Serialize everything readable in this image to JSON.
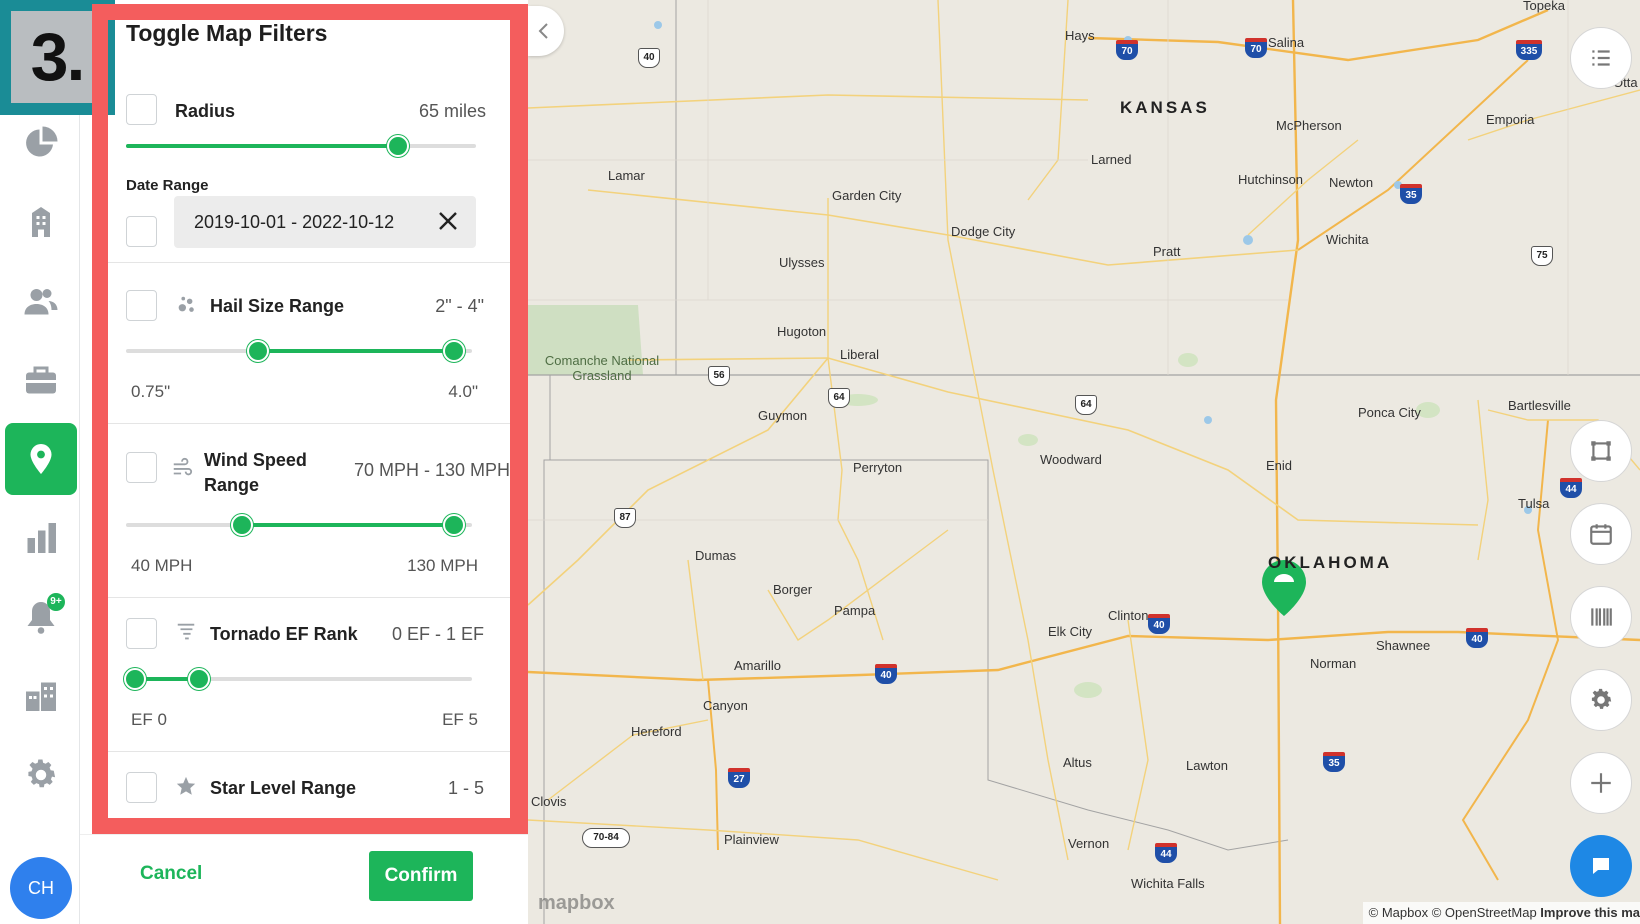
{
  "step_badge": "3.",
  "nav": {
    "items": [
      {
        "name": "dashboard"
      },
      {
        "name": "buildings"
      },
      {
        "name": "contacts"
      },
      {
        "name": "jobs"
      },
      {
        "name": "map"
      },
      {
        "name": "reports"
      },
      {
        "name": "notifications",
        "badge": "9+"
      },
      {
        "name": "organization"
      },
      {
        "name": "settings"
      }
    ],
    "avatar_initials": "CH"
  },
  "filters": {
    "title": "Toggle Map Filters",
    "radius": {
      "label": "Radius",
      "value": "65 miles"
    },
    "date_range": {
      "label": "Date Range",
      "value": "2019-10-01 - 2022-10-12"
    },
    "hail": {
      "label": "Hail Size Range",
      "value": "2\" - 4\"",
      "min": "0.75\"",
      "max": "4.0\""
    },
    "wind": {
      "label": "Wind Speed Range",
      "value": "70 MPH - 130 MPH",
      "min": "40 MPH",
      "max": "130 MPH"
    },
    "tornado": {
      "label": "Tornado EF Rank",
      "value": "0 EF - 1 EF",
      "min": "EF 0",
      "max": "EF 5"
    },
    "star": {
      "label": "Star Level Range",
      "value": "1 - 5"
    },
    "cancel_label": "Cancel",
    "confirm_label": "Confirm"
  },
  "map": {
    "states": {
      "kansas": "KANSAS",
      "oklahoma": "OKLAHOMA"
    },
    "cities": {
      "topeka": "Topeka",
      "hays": "Hays",
      "salina": "Salina",
      "mcpherson": "McPherson",
      "emporia": "Emporia",
      "otta": "Otta",
      "larned": "Larned",
      "lamar": "Lamar",
      "hutchinson": "Hutchinson",
      "newton": "Newton",
      "garden_city": "Garden City",
      "dodge_city": "Dodge City",
      "wichita": "Wichita",
      "pratt": "Pratt",
      "ulysses": "Ulysses",
      "hugoton": "Hugoton",
      "liberal": "Liberal",
      "comanche": "Comanche National Grassland",
      "guymon": "Guymon",
      "ponca_city": "Ponca City",
      "bartlesville": "Bartlesville",
      "perryton": "Perryton",
      "woodward": "Woodward",
      "enid": "Enid",
      "tulsa": "Tulsa",
      "dumas": "Dumas",
      "borger": "Borger",
      "pampa": "Pampa",
      "clinton": "Clinton",
      "elk_city": "Elk City",
      "shawnee": "Shawnee",
      "norman": "Norman",
      "amarillo": "Amarillo",
      "canyon": "Canyon",
      "hereford": "Hereford",
      "altus": "Altus",
      "lawton": "Lawton",
      "clovis": "Clovis",
      "plainview": "Plainview",
      "vernon": "Vernon",
      "wichita_falls": "Wichita Falls"
    },
    "shields": {
      "us40": "40",
      "i70a": "70",
      "i70b": "70",
      "i335": "335",
      "i35a": "35",
      "us75": "75",
      "us56": "56",
      "us64a": "64",
      "us64b": "64",
      "us87": "87",
      "i44a": "44",
      "i40a": "40",
      "i40b": "40",
      "i40c": "40",
      "i27": "27",
      "i35b": "35",
      "us7084": "70-84",
      "i44b": "44"
    },
    "mapbox_logo": "mapbox",
    "attribution": {
      "mapbox": "© Mapbox",
      "osm": "© OpenStreetMap",
      "improve": "Improve this ma"
    }
  }
}
